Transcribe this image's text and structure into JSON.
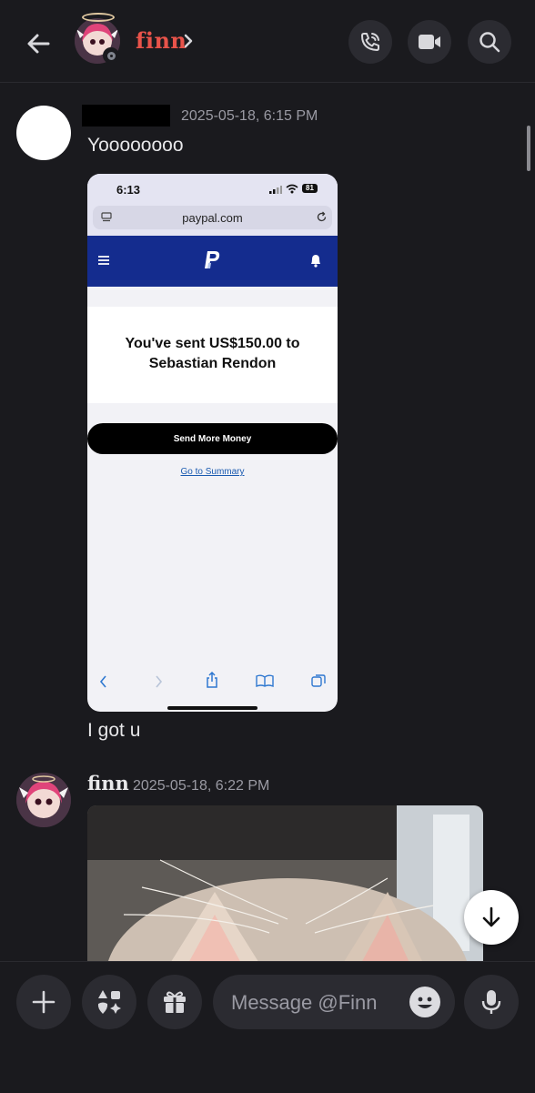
{
  "header": {
    "contact_name": "finn",
    "back_icon": "arrow-left-icon",
    "call_icon": "phone-call-icon",
    "video_icon": "video-camera-icon",
    "search_icon": "search-icon"
  },
  "messages": [
    {
      "author": "",
      "timestamp": "2025-05-18, 6:15 PM",
      "lines": [
        "Yoooooooo",
        "I got u"
      ],
      "attachment": {
        "type": "screenshot",
        "status_time": "6:13",
        "battery": "81",
        "url": "paypal.com",
        "headline": "You've sent US$150.00 to Sebastian Rendon",
        "button": "Send More Money",
        "link": "Go to Summary"
      }
    },
    {
      "author": "finn",
      "timestamp": "2025-05-18, 6:22 PM",
      "attachment": {
        "type": "image"
      }
    }
  ],
  "composer": {
    "placeholder": "Message @Finn",
    "add_icon": "plus-icon",
    "apps_icon": "apps-icon",
    "gift_icon": "gift-icon",
    "emoji_icon": "emoji-icon",
    "mic_icon": "microphone-icon"
  },
  "colors": {
    "background": "#1a1a1e",
    "username": "#e8534a",
    "button_bg": "#2b2b31",
    "paypal_blue": "#142c8e"
  }
}
